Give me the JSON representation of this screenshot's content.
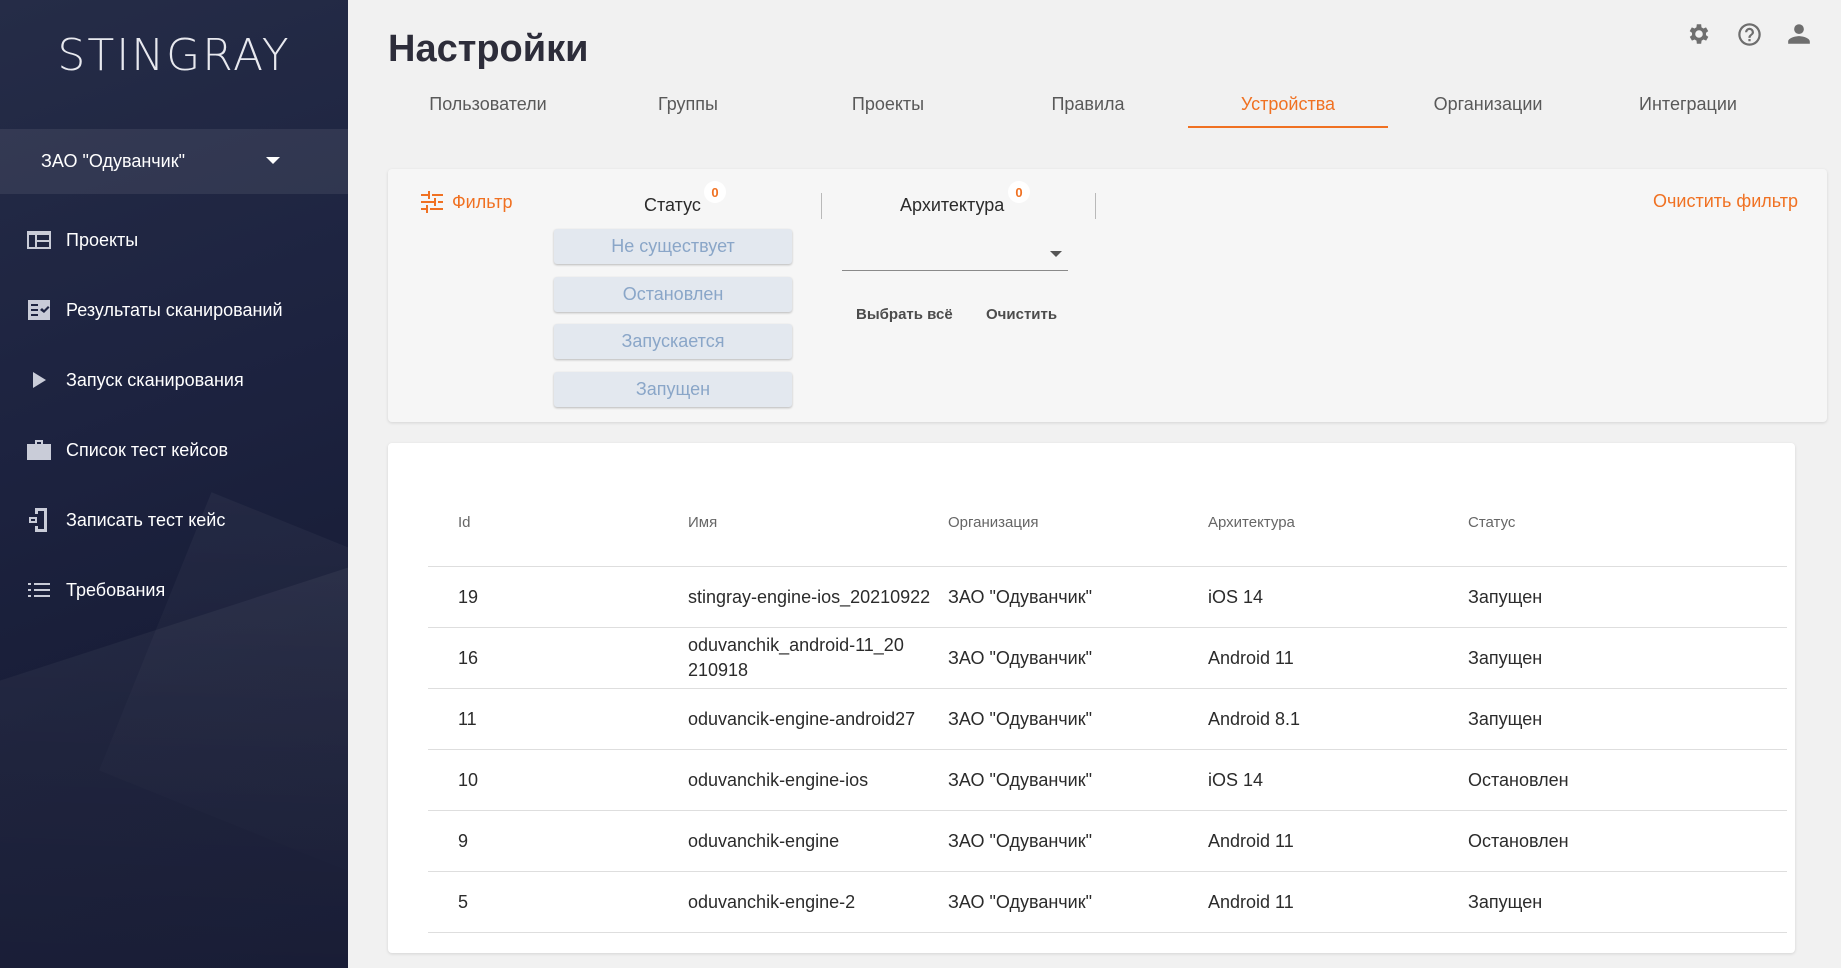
{
  "app": {
    "logo": "STINGRAY"
  },
  "sidebar": {
    "org_select": "ЗАО \"Одуванчик\"",
    "items": [
      {
        "label": "Проекты",
        "icon": "projects-icon"
      },
      {
        "label": "Результаты сканирований",
        "icon": "scan-results-icon"
      },
      {
        "label": "Запуск сканирования",
        "icon": "play-icon"
      },
      {
        "label": "Список тест кейсов",
        "icon": "briefcase-icon"
      },
      {
        "label": "Записать тест кейс",
        "icon": "record-device-icon"
      },
      {
        "label": "Требования",
        "icon": "list-icon"
      }
    ]
  },
  "header": {
    "title": "Настройки",
    "icons": [
      "gear-icon",
      "help-icon",
      "user-icon"
    ]
  },
  "tabs": [
    {
      "label": "Пользователи",
      "active": false
    },
    {
      "label": "Группы",
      "active": false
    },
    {
      "label": "Проекты",
      "active": false
    },
    {
      "label": "Правила",
      "active": false
    },
    {
      "label": "Устройства",
      "active": true
    },
    {
      "label": "Организации",
      "active": false
    },
    {
      "label": "Интеграции",
      "active": false
    }
  ],
  "filter": {
    "toggle_label": "Фильтр",
    "clear_label": "Очистить фильтр",
    "status": {
      "label": "Статус",
      "count": "0",
      "options": [
        "Не существует",
        "Остановлен",
        "Запускается",
        "Запущен"
      ]
    },
    "architecture": {
      "label": "Архитектура",
      "count": "0",
      "value": "",
      "select_all": "Выбрать всё",
      "clear": "Очистить"
    }
  },
  "table": {
    "columns": [
      "Id",
      "Имя",
      "Организация",
      "Архитектура",
      "Статус"
    ],
    "rows": [
      {
        "id": "19",
        "name": "stingray-engine-ios_20210922",
        "org": "ЗАО \"Одуванчик\"",
        "arch": "iOS 14",
        "status": "Запущен"
      },
      {
        "id": "16",
        "name": "oduvanchik_android-11_20210918",
        "org": "ЗАО \"Одуванчик\"",
        "arch": "Android 11",
        "status": "Запущен"
      },
      {
        "id": "11",
        "name": "oduvancik-engine-android27",
        "org": "ЗАО \"Одуванчик\"",
        "arch": "Android 8.1",
        "status": "Запущен"
      },
      {
        "id": "10",
        "name": "oduvanchik-engine-ios",
        "org": "ЗАО \"Одуванчик\"",
        "arch": "iOS 14",
        "status": "Остановлен"
      },
      {
        "id": "9",
        "name": "oduvanchik-engine",
        "org": "ЗАО \"Одуванчик\"",
        "arch": "Android 11",
        "status": "Остановлен"
      },
      {
        "id": "5",
        "name": "oduvanchik-engine-2",
        "org": "ЗАО \"Одуванчик\"",
        "arch": "Android 11",
        "status": "Запущен"
      }
    ]
  },
  "colors": {
    "accent": "#f07122",
    "sidebar_bg": "#1d2340",
    "status_btn_text": "#8aa6c8"
  }
}
